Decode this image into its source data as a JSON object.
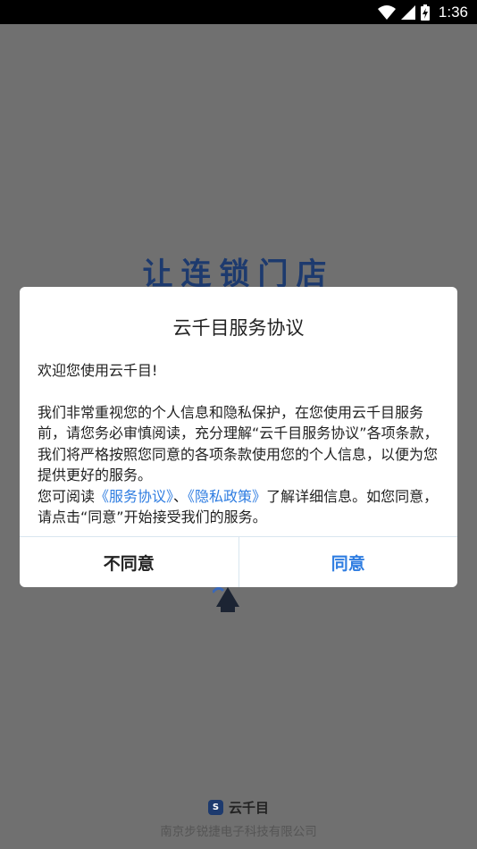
{
  "status_bar": {
    "time": "1:36"
  },
  "splash": {
    "slogan": "让连锁门店",
    "brand_name": "云千目",
    "company": "南京步锐捷电子科技有限公司"
  },
  "dialog": {
    "title": "云千目服务协议",
    "welcome": "欢迎您使用云千目!",
    "paragraph": "我们非常重视您的个人信息和隐私保护，在您使用云千目服务前，请您务必审慎阅读，充分理解“云千目服务协议”各项条款，我们将严格按照您同意的各项条款使用您的个人信息，以便为您提供更好的服务。",
    "read_prefix": "您可阅读",
    "service_link": "《服务协议》",
    "separator": "、",
    "privacy_link": "《隐私政策》",
    "read_suffix": "了解详细信息。如您同意，请点击“同意”开始接受我们的服务。",
    "disagree_label": "不同意",
    "agree_label": "同意"
  },
  "colors": {
    "accent": "#2f7de1",
    "overlay": "#707070",
    "brand": "#1d3a6e"
  }
}
